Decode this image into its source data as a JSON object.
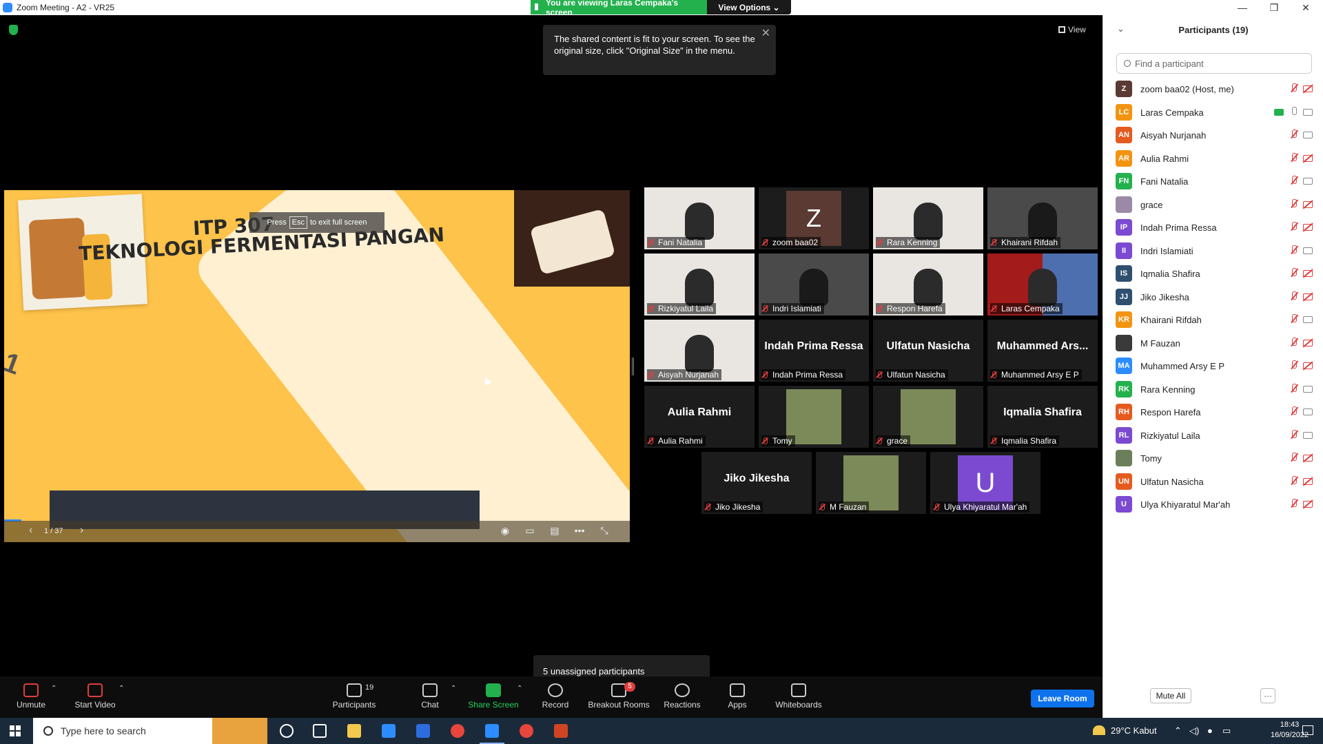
{
  "window": {
    "title": "Zoom Meeting - A2 - VR25",
    "minimize_icon": "—",
    "maximize_icon": "❐",
    "close_icon": "✕"
  },
  "share_banner": {
    "text": "You are viewing Laras Cempaka's screen",
    "view_options": "View Options ⌄"
  },
  "view_button": "View",
  "toast": {
    "message": "The shared content is fit to your screen. To see the original size, click \"Original Size\" in the menu.",
    "close_icon": "✕"
  },
  "slide": {
    "title_line1": "ITP 307",
    "title_line2": "TEKNOLOGI FERMENTASI PANGAN",
    "esc_before": "Press",
    "esc_key": "Esc",
    "esc_after": "to exit full screen",
    "counter": "1 / 37",
    "prev_icon": "‹",
    "next_icon": "›",
    "side_mark": "1"
  },
  "gallery": [
    {
      "name": "Fani Natalia",
      "kind": "video-light"
    },
    {
      "name": "zoom baa02",
      "kind": "avatar-z",
      "avatar": "Z"
    },
    {
      "name": "Rara Kenning",
      "kind": "video-light"
    },
    {
      "name": "Khairani Rifdah",
      "kind": "video-dark"
    },
    {
      "name": "Rizkiyatul Laila",
      "kind": "video-light"
    },
    {
      "name": "Indri Islamiati",
      "kind": "video-dark"
    },
    {
      "name": "Respon Harefa",
      "kind": "video-light"
    },
    {
      "name": "Laras Cempaka",
      "kind": "video-red",
      "active": true
    },
    {
      "name": "Aisyah Nurjanah",
      "kind": "video-light"
    },
    {
      "name": "Indah Prima Ressa",
      "kind": "text",
      "big": "Indah Prima Ressa"
    },
    {
      "name": "Ulfatun Nasicha",
      "kind": "text",
      "big": "Ulfatun Nasicha"
    },
    {
      "name": "Muhammed Arsy E P",
      "kind": "text",
      "big": "Muhammed Ars..."
    },
    {
      "name": "Aulia Rahmi",
      "kind": "text",
      "big": "Aulia Rahmi"
    },
    {
      "name": "Tomy",
      "kind": "pic"
    },
    {
      "name": "grace",
      "kind": "pic"
    },
    {
      "name": "Iqmalia Shafira",
      "kind": "text",
      "big": "Iqmalia Shafira"
    },
    {
      "name": "Jiko Jikesha",
      "kind": "text",
      "big": "Jiko Jikesha"
    },
    {
      "name": "M Fauzan",
      "kind": "pic"
    },
    {
      "name": "Ulya Khiyaratul Mar'ah",
      "kind": "avatar-u",
      "avatar": "U"
    }
  ],
  "unassigned": "5 unassigned participants",
  "toolbar": {
    "unmute": "Unmute",
    "start_video": "Start Video",
    "participants": "Participants",
    "participants_count": "19",
    "chat": "Chat",
    "share_screen": "Share Screen",
    "record": "Record",
    "breakout_rooms": "Breakout Rooms",
    "breakout_badge": "5",
    "reactions": "Reactions",
    "apps": "Apps",
    "whiteboards": "Whiteboards",
    "leave_room": "Leave Room"
  },
  "panel": {
    "title": "Participants (19)",
    "search_placeholder": "Find a participant",
    "mute_all": "Mute All",
    "more": "···",
    "participants": [
      {
        "initials": "Z",
        "name": "zoom baa02 (Host, me)",
        "color": "#5a3a32",
        "mic_muted": true,
        "cam_off": true
      },
      {
        "initials": "LC",
        "name": "Laras Cempaka",
        "color": "#f29412",
        "mic_muted": false,
        "cam_off": false,
        "sharing": true
      },
      {
        "initials": "AN",
        "name": "Aisyah Nurjanah",
        "color": "#e55b1f",
        "mic_muted": true,
        "cam_off": false
      },
      {
        "initials": "AR",
        "name": "Aulia Rahmi",
        "color": "#f29412",
        "mic_muted": true,
        "cam_off": true
      },
      {
        "initials": "FN",
        "name": "Fani Natalia",
        "color": "#23b14d",
        "mic_muted": true,
        "cam_off": false
      },
      {
        "initials": "",
        "name": "grace",
        "color": "#9b8aa6",
        "mic_muted": true,
        "cam_off": true
      },
      {
        "initials": "IP",
        "name": "Indah Prima Ressa",
        "color": "#7b4ad1",
        "mic_muted": true,
        "cam_off": true
      },
      {
        "initials": "II",
        "name": "Indri Islamiati",
        "color": "#7b4ad1",
        "mic_muted": true,
        "cam_off": false
      },
      {
        "initials": "IS",
        "name": "Iqmalia Shafira",
        "color": "#2f4f6f",
        "mic_muted": true,
        "cam_off": true
      },
      {
        "initials": "JJ",
        "name": "Jiko Jikesha",
        "color": "#2f4f6f",
        "mic_muted": true,
        "cam_off": true
      },
      {
        "initials": "KR",
        "name": "Khairani Rifdah",
        "color": "#f29412",
        "mic_muted": true,
        "cam_off": false
      },
      {
        "initials": "",
        "name": "M Fauzan",
        "color": "#3a3a3a",
        "mic_muted": true,
        "cam_off": true
      },
      {
        "initials": "MA",
        "name": "Muhammed Arsy E P",
        "color": "#2d8cff",
        "mic_muted": true,
        "cam_off": true
      },
      {
        "initials": "RK",
        "name": "Rara Kenning",
        "color": "#23b14d",
        "mic_muted": true,
        "cam_off": false
      },
      {
        "initials": "RH",
        "name": "Respon Harefa",
        "color": "#e55b1f",
        "mic_muted": true,
        "cam_off": false
      },
      {
        "initials": "RL",
        "name": "Rizkiyatul Laila",
        "color": "#7b4ad1",
        "mic_muted": true,
        "cam_off": false
      },
      {
        "initials": "",
        "name": "Tomy",
        "color": "#6b7f5a",
        "mic_muted": true,
        "cam_off": true
      },
      {
        "initials": "UN",
        "name": "Ulfatun Nasicha",
        "color": "#e55b1f",
        "mic_muted": true,
        "cam_off": true
      },
      {
        "initials": "U",
        "name": "Ulya Khiyaratul Mar'ah",
        "color": "#7b4ad1",
        "mic_muted": true,
        "cam_off": true
      }
    ]
  },
  "taskbar": {
    "search_placeholder": "Type here to search",
    "weather": "29°C  Kabut",
    "time": "18:43",
    "date": "16/09/2022"
  }
}
